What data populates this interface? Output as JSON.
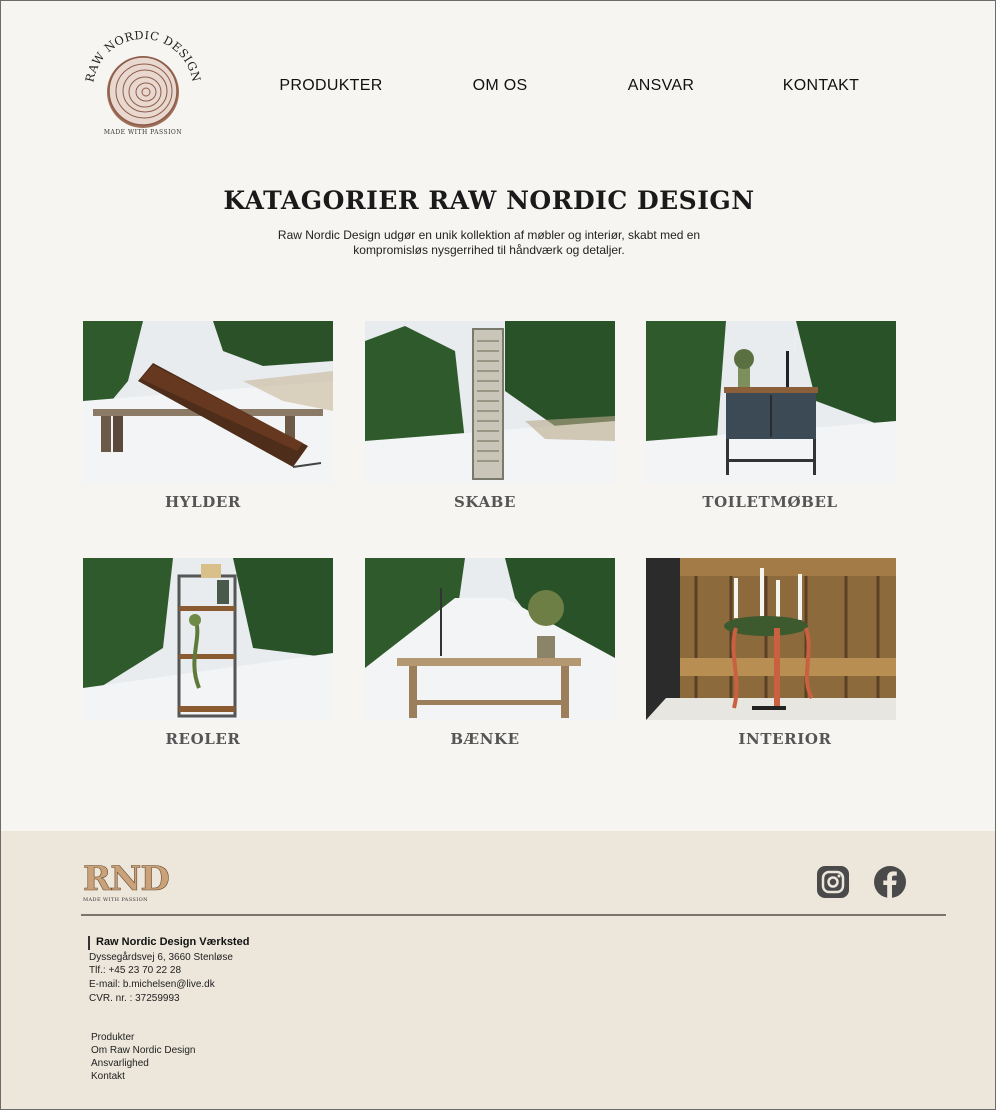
{
  "header": {
    "logo_text": "RAW NORDIC DESIGN",
    "logo_tagline": "MADE WITH PASSION",
    "nav": [
      "PRODUKTER",
      "OM OS",
      "ANSVAR",
      "KONTAKT"
    ]
  },
  "main": {
    "title": "KATAGORIER RAW NORDIC DESIGN",
    "intro": "Raw Nordic Design udgør en unik kollektion af møbler og interiør, skabt med en kompromisløs nysgerrihed til håndværk og detaljer.",
    "categories": [
      {
        "label": "HYLDER",
        "image": "snowy bench with wooden shelf"
      },
      {
        "label": "SKABE",
        "image": "tall narrow cabinet in snow"
      },
      {
        "label": "TOILETMØBEL",
        "image": "washstand cabinet in forest"
      },
      {
        "label": "REOLER",
        "image": "tall bookshelf with plants"
      },
      {
        "label": "BÆNKE",
        "image": "wooden bench on snowy path"
      },
      {
        "label": "INTERIOR",
        "image": "candle holders against wooden wall"
      }
    ]
  },
  "footer": {
    "logo_text": "RND",
    "logo_tagline": "MADE WITH PASSION",
    "social": [
      "instagram-icon",
      "facebook-icon"
    ],
    "company": "Raw Nordic Design Værksted",
    "address": "Dyssegårdsvej 6, 3660 Stenløse",
    "phone": "Tlf.: +45 23 70 22 28",
    "email": "E-mail: b.michelsen@live.dk",
    "cvr": "CVR. nr. : 37259993",
    "links": [
      "Produkter",
      "Om Raw Nordic Design",
      "Ansvarlighed",
      "Kontakt"
    ]
  },
  "colors": {
    "page_bg": "#f6f5f2",
    "footer_bg": "#ece6db",
    "snow": "#f1f2f3",
    "tree": "#2f5a2d",
    "wood": "#6b3f22"
  }
}
